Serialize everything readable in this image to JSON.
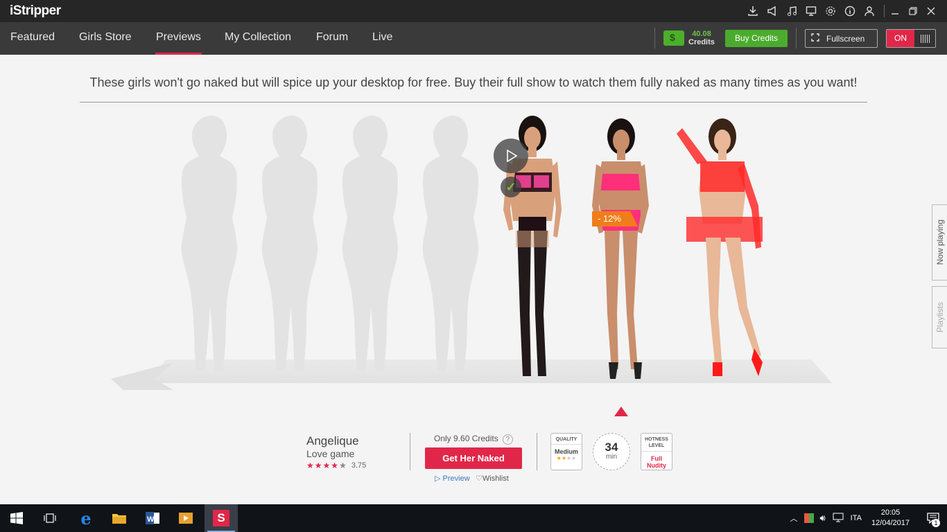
{
  "app": {
    "title": "iStripper"
  },
  "titlebar": {
    "icons": [
      "download-icon",
      "megaphone-icon",
      "music-icon",
      "monitor-icon",
      "gear-icon",
      "info-icon",
      "user-icon"
    ],
    "window_controls": [
      "minimize-icon",
      "restore-icon",
      "close-icon"
    ]
  },
  "nav": {
    "items": [
      {
        "label": "Featured",
        "active": false
      },
      {
        "label": "Girls Store",
        "active": false
      },
      {
        "label": "Previews",
        "active": true
      },
      {
        "label": "My Collection",
        "active": false
      },
      {
        "label": "Forum",
        "active": false
      },
      {
        "label": "Live",
        "active": false
      }
    ],
    "credits_amount": "40.08",
    "credits_label": "Credits",
    "buy_credits": "Buy Credits",
    "fullscreen": "Fullscreen",
    "toggle": "ON"
  },
  "main": {
    "headline": "These girls won't go naked but will spice up your desktop for free. Buy their full show to watch them fully naked as many times as you want!",
    "discount": "- 12%",
    "side_tabs": [
      "Now playing",
      "Playlists"
    ]
  },
  "selected": {
    "name": "Angelique",
    "show": "Love game",
    "rating": "3.75",
    "rating_value": 3.75,
    "price_text": "Only 9.60 Credits",
    "help": "?",
    "cta": "Get Her Naked",
    "preview": "Preview",
    "wishlist": "Wishlist",
    "quality_title": "QUALITY",
    "quality": "Medium",
    "duration": "34",
    "duration_unit": "min",
    "hotness_title": "HOTNESS LEVEL",
    "hotness": "Full Nudity"
  },
  "taskbar": {
    "language": "ITA",
    "time": "20:05",
    "date": "12/04/2017",
    "notifications": "1"
  },
  "colors": {
    "accent": "#e0274a",
    "green": "#4bab2e",
    "orange": "#f07d1a"
  }
}
